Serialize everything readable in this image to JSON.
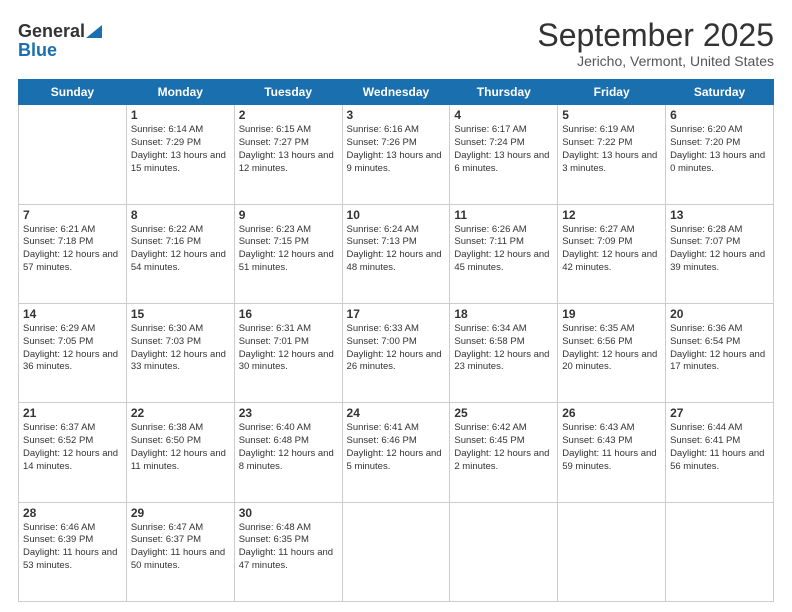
{
  "logo": {
    "general": "General",
    "blue": "Blue"
  },
  "header": {
    "month": "September 2025",
    "location": "Jericho, Vermont, United States"
  },
  "days_of_week": [
    "Sunday",
    "Monday",
    "Tuesday",
    "Wednesday",
    "Thursday",
    "Friday",
    "Saturday"
  ],
  "weeks": [
    [
      {
        "day": "",
        "sunrise": "",
        "sunset": "",
        "daylight": ""
      },
      {
        "day": "1",
        "sunrise": "Sunrise: 6:14 AM",
        "sunset": "Sunset: 7:29 PM",
        "daylight": "Daylight: 13 hours and 15 minutes."
      },
      {
        "day": "2",
        "sunrise": "Sunrise: 6:15 AM",
        "sunset": "Sunset: 7:27 PM",
        "daylight": "Daylight: 13 hours and 12 minutes."
      },
      {
        "day": "3",
        "sunrise": "Sunrise: 6:16 AM",
        "sunset": "Sunset: 7:26 PM",
        "daylight": "Daylight: 13 hours and 9 minutes."
      },
      {
        "day": "4",
        "sunrise": "Sunrise: 6:17 AM",
        "sunset": "Sunset: 7:24 PM",
        "daylight": "Daylight: 13 hours and 6 minutes."
      },
      {
        "day": "5",
        "sunrise": "Sunrise: 6:19 AM",
        "sunset": "Sunset: 7:22 PM",
        "daylight": "Daylight: 13 hours and 3 minutes."
      },
      {
        "day": "6",
        "sunrise": "Sunrise: 6:20 AM",
        "sunset": "Sunset: 7:20 PM",
        "daylight": "Daylight: 13 hours and 0 minutes."
      }
    ],
    [
      {
        "day": "7",
        "sunrise": "Sunrise: 6:21 AM",
        "sunset": "Sunset: 7:18 PM",
        "daylight": "Daylight: 12 hours and 57 minutes."
      },
      {
        "day": "8",
        "sunrise": "Sunrise: 6:22 AM",
        "sunset": "Sunset: 7:16 PM",
        "daylight": "Daylight: 12 hours and 54 minutes."
      },
      {
        "day": "9",
        "sunrise": "Sunrise: 6:23 AM",
        "sunset": "Sunset: 7:15 PM",
        "daylight": "Daylight: 12 hours and 51 minutes."
      },
      {
        "day": "10",
        "sunrise": "Sunrise: 6:24 AM",
        "sunset": "Sunset: 7:13 PM",
        "daylight": "Daylight: 12 hours and 48 minutes."
      },
      {
        "day": "11",
        "sunrise": "Sunrise: 6:26 AM",
        "sunset": "Sunset: 7:11 PM",
        "daylight": "Daylight: 12 hours and 45 minutes."
      },
      {
        "day": "12",
        "sunrise": "Sunrise: 6:27 AM",
        "sunset": "Sunset: 7:09 PM",
        "daylight": "Daylight: 12 hours and 42 minutes."
      },
      {
        "day": "13",
        "sunrise": "Sunrise: 6:28 AM",
        "sunset": "Sunset: 7:07 PM",
        "daylight": "Daylight: 12 hours and 39 minutes."
      }
    ],
    [
      {
        "day": "14",
        "sunrise": "Sunrise: 6:29 AM",
        "sunset": "Sunset: 7:05 PM",
        "daylight": "Daylight: 12 hours and 36 minutes."
      },
      {
        "day": "15",
        "sunrise": "Sunrise: 6:30 AM",
        "sunset": "Sunset: 7:03 PM",
        "daylight": "Daylight: 12 hours and 33 minutes."
      },
      {
        "day": "16",
        "sunrise": "Sunrise: 6:31 AM",
        "sunset": "Sunset: 7:01 PM",
        "daylight": "Daylight: 12 hours and 30 minutes."
      },
      {
        "day": "17",
        "sunrise": "Sunrise: 6:33 AM",
        "sunset": "Sunset: 7:00 PM",
        "daylight": "Daylight: 12 hours and 26 minutes."
      },
      {
        "day": "18",
        "sunrise": "Sunrise: 6:34 AM",
        "sunset": "Sunset: 6:58 PM",
        "daylight": "Daylight: 12 hours and 23 minutes."
      },
      {
        "day": "19",
        "sunrise": "Sunrise: 6:35 AM",
        "sunset": "Sunset: 6:56 PM",
        "daylight": "Daylight: 12 hours and 20 minutes."
      },
      {
        "day": "20",
        "sunrise": "Sunrise: 6:36 AM",
        "sunset": "Sunset: 6:54 PM",
        "daylight": "Daylight: 12 hours and 17 minutes."
      }
    ],
    [
      {
        "day": "21",
        "sunrise": "Sunrise: 6:37 AM",
        "sunset": "Sunset: 6:52 PM",
        "daylight": "Daylight: 12 hours and 14 minutes."
      },
      {
        "day": "22",
        "sunrise": "Sunrise: 6:38 AM",
        "sunset": "Sunset: 6:50 PM",
        "daylight": "Daylight: 12 hours and 11 minutes."
      },
      {
        "day": "23",
        "sunrise": "Sunrise: 6:40 AM",
        "sunset": "Sunset: 6:48 PM",
        "daylight": "Daylight: 12 hours and 8 minutes."
      },
      {
        "day": "24",
        "sunrise": "Sunrise: 6:41 AM",
        "sunset": "Sunset: 6:46 PM",
        "daylight": "Daylight: 12 hours and 5 minutes."
      },
      {
        "day": "25",
        "sunrise": "Sunrise: 6:42 AM",
        "sunset": "Sunset: 6:45 PM",
        "daylight": "Daylight: 12 hours and 2 minutes."
      },
      {
        "day": "26",
        "sunrise": "Sunrise: 6:43 AM",
        "sunset": "Sunset: 6:43 PM",
        "daylight": "Daylight: 11 hours and 59 minutes."
      },
      {
        "day": "27",
        "sunrise": "Sunrise: 6:44 AM",
        "sunset": "Sunset: 6:41 PM",
        "daylight": "Daylight: 11 hours and 56 minutes."
      }
    ],
    [
      {
        "day": "28",
        "sunrise": "Sunrise: 6:46 AM",
        "sunset": "Sunset: 6:39 PM",
        "daylight": "Daylight: 11 hours and 53 minutes."
      },
      {
        "day": "29",
        "sunrise": "Sunrise: 6:47 AM",
        "sunset": "Sunset: 6:37 PM",
        "daylight": "Daylight: 11 hours and 50 minutes."
      },
      {
        "day": "30",
        "sunrise": "Sunrise: 6:48 AM",
        "sunset": "Sunset: 6:35 PM",
        "daylight": "Daylight: 11 hours and 47 minutes."
      },
      {
        "day": "",
        "sunrise": "",
        "sunset": "",
        "daylight": ""
      },
      {
        "day": "",
        "sunrise": "",
        "sunset": "",
        "daylight": ""
      },
      {
        "day": "",
        "sunrise": "",
        "sunset": "",
        "daylight": ""
      },
      {
        "day": "",
        "sunrise": "",
        "sunset": "",
        "daylight": ""
      }
    ]
  ]
}
